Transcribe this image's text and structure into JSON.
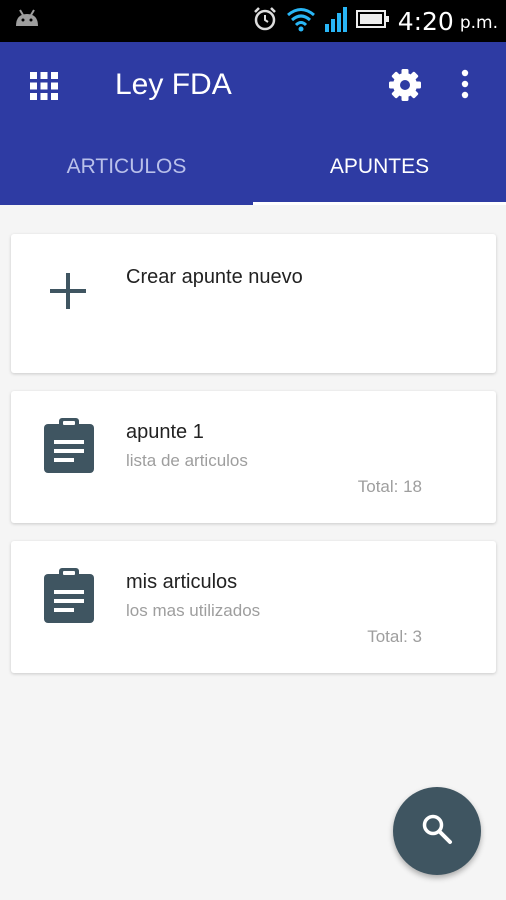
{
  "status_bar": {
    "time": "4:20",
    "ampm": "p.m."
  },
  "app_bar": {
    "title": "Ley FDA"
  },
  "tabs": [
    {
      "label": "ARTICULOS",
      "active": false
    },
    {
      "label": "APUNTES",
      "active": true
    }
  ],
  "create_card": {
    "label": "Crear apunte nuevo"
  },
  "notes": [
    {
      "title": "apunte 1",
      "subtitle": "lista de articulos",
      "total": "Total: 18"
    },
    {
      "title": "mis articulos",
      "subtitle": "los mas utilizados",
      "total": "Total: 3"
    }
  ],
  "icons": {
    "status_left": "android-icon",
    "status_right": [
      "alarm-icon",
      "wifi-icon",
      "signal-icon",
      "battery-icon"
    ],
    "nav": "grid-icon",
    "actions": [
      "gear-icon",
      "more-vert-icon"
    ],
    "create": "plus-icon",
    "note": "clipboard-icon",
    "fab": "search-icon"
  },
  "colors": {
    "app_bar": "#2e3ba3",
    "icon_dark": "#3f5561",
    "fab": "#3f5561",
    "background": "#f5f5f5"
  }
}
